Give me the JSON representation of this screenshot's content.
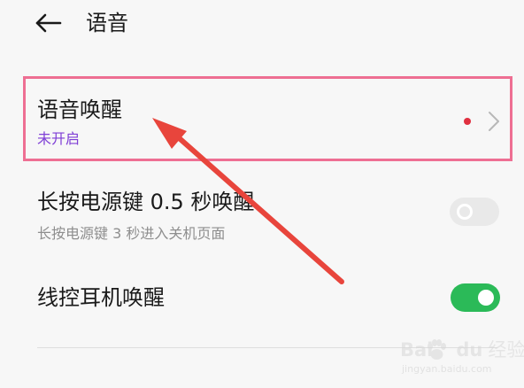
{
  "header": {
    "back_icon": "arrow-left-icon",
    "title": "语音"
  },
  "settings": {
    "voice_wake": {
      "title": "语音唤醒",
      "status": "未开启",
      "has_notification_dot": true,
      "icon": "chevron-right-icon"
    },
    "power_key_wake": {
      "title": "长按电源键 0.5 秒唤醒",
      "subtitle": "长按电源键 3 秒进入关机页面",
      "enabled": false
    },
    "headset_wake": {
      "title": "线控耳机唤醒",
      "enabled": true
    }
  },
  "colors": {
    "highlight_border": "#ee6f93",
    "annotation_arrow": "#e8453c",
    "status_text": "#7f3fd6",
    "toggle_on": "#2bba58",
    "toggle_off": "#e9e9e9",
    "notification_dot": "#e03040"
  },
  "watermark": {
    "logo_bai": "Bai",
    "logo_du": "du",
    "logo_jingyan": "经验",
    "url": "jingyan.baidu.com"
  }
}
